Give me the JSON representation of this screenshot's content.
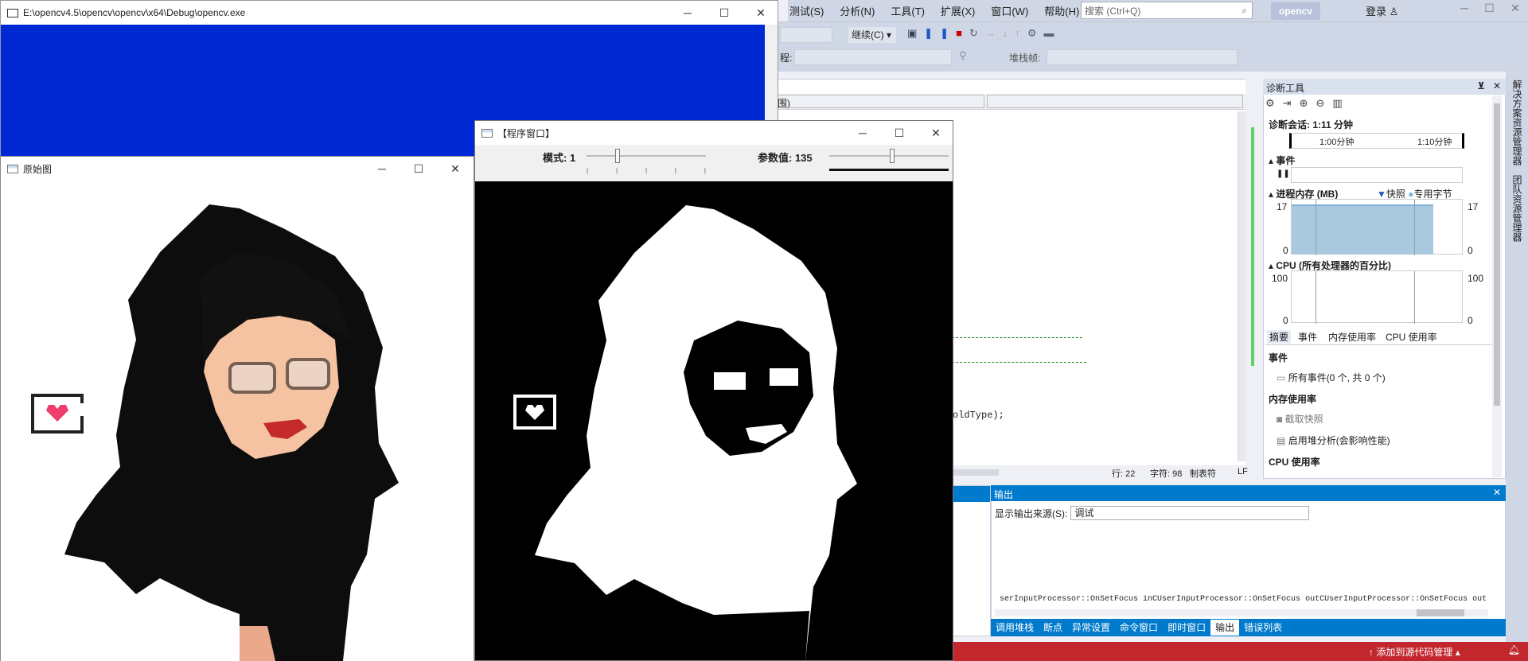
{
  "console": {
    "title": "E:\\opencv4.5\\opencv\\opencv\\x64\\Debug\\opencv.exe"
  },
  "orig_window": {
    "title": "原始图"
  },
  "prog_window": {
    "title": "【程序窗口】",
    "trackbar1_label": "模式: 1",
    "trackbar2_label": "参数值: 135",
    "trackbar1_value": 1,
    "trackbar1_max": 4,
    "trackbar2_value": 135,
    "trackbar2_max": 255
  },
  "vs": {
    "menu": [
      "测试(S)",
      "分析(N)",
      "工具(T)",
      "扩展(X)",
      "窗口(W)",
      "帮助(H)"
    ],
    "search_placeholder": "搜索 (Ctrl+Q)",
    "solution_name": "opencv",
    "login_label": "登录",
    "continue_label": "继续(C)",
    "stack_frame_label": "堆栈帧:",
    "process_label": "程:",
    "scope_text": "围)",
    "code_fragment": "oldType);",
    "status_line": "行: 22",
    "status_char": "字符: 98",
    "status_tab": "制表符",
    "status_eol": "LF"
  },
  "diag": {
    "title": "诊断工具",
    "session": "诊断会话: 1:11 分钟",
    "tick1": "1:00分钟",
    "tick2": "1:10分钟",
    "events_label": "事件",
    "memory_label": "进程内存 (MB)",
    "snapshot_legend": "快照",
    "private_legend": "专用字节",
    "mem_max": "17",
    "mem_min": "0",
    "cpu_label": "CPU (所有处理器的百分比)",
    "cpu_max": "100",
    "cpu_min": "0",
    "tabs": [
      "摘要",
      "事件",
      "内存使用率",
      "CPU 使用率"
    ],
    "section_events": "事件",
    "all_events": "所有事件(0 个, 共 0 个)",
    "section_memory": "内存使用率",
    "take_snapshot": "截取快照",
    "heap_profiling": "启用堆分析(会影响性能)",
    "section_cpu": "CPU 使用率"
  },
  "output": {
    "title": "输出",
    "source_label": "显示输出来源(S):",
    "source_value": "调试",
    "text": "serInputProcessor::OnSetFocus inCUserInputProcessor::OnSetFocus outCUserInputProcessor::OnSetFocus out",
    "tabs": [
      "调用堆栈",
      "断点",
      "异常设置",
      "命令窗口",
      "即时窗口",
      "输出",
      "错误列表"
    ]
  },
  "sidebar": {
    "items": [
      "解决方案资源管理器",
      "团队资源管理器"
    ]
  },
  "status": {
    "source_control": "添加到源代码管理"
  },
  "colors": {
    "vs_status": "#c1272d",
    "vs_chrome": "#cfd6e5",
    "console_bg": "#0029d4",
    "skin": "#f5c3a1",
    "accent": "#007acc"
  }
}
